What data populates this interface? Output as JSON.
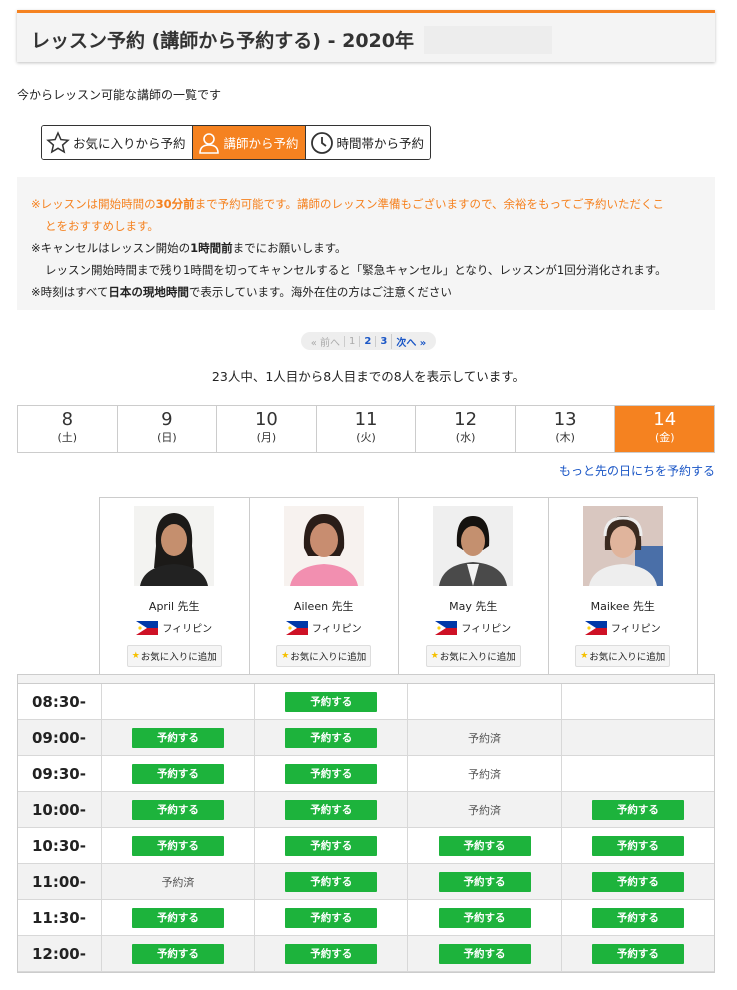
{
  "header": {
    "title": "レッスン予約 (講師から予約する) - 2020年"
  },
  "intro": "今からレッスン可能な講師の一覧です",
  "tabs": [
    {
      "label": "お気に入りから予約",
      "icon": "star-icon",
      "active": false
    },
    {
      "label": "講師から予約",
      "icon": "person-icon",
      "active": true
    },
    {
      "label": "時間帯から予約",
      "icon": "clock-icon",
      "active": false
    }
  ],
  "notice": {
    "line1a": "※レッスンは開始時間の",
    "line1b": "30分前",
    "line1c": "まで予約可能です。講師のレッスン準備もございますので、余裕をもってご予約いただくこ",
    "line1d": "とをおすすめします。",
    "line2a": "※キャンセルはレッスン開始の",
    "line2b": "1時間前",
    "line2c": "までにお願いします。",
    "line3": "レッスン開始時間まで残り1時間を切ってキャンセルすると「緊急キャンセル」となり、レッスンが1回分消化されます。",
    "line4a": "※時刻はすべて",
    "line4b": "日本の現地時間",
    "line4c": "で表示しています。海外在住の方はご注意ください"
  },
  "pager": {
    "prev": "« 前へ",
    "p1": "1",
    "p2": "2",
    "p3": "3",
    "next": "次へ »"
  },
  "count_text": "23人中、1人目から8人目までの8人を表示しています。",
  "days": [
    {
      "num": "8",
      "wd": "(土)"
    },
    {
      "num": "9",
      "wd": "(日)"
    },
    {
      "num": "10",
      "wd": "(月)"
    },
    {
      "num": "11",
      "wd": "(火)"
    },
    {
      "num": "12",
      "wd": "(水)"
    },
    {
      "num": "13",
      "wd": "(木)"
    },
    {
      "num": "14",
      "wd": "(金)"
    }
  ],
  "more_link": "もっと先の日にちを予約する",
  "teachers": [
    {
      "name": "April 先生",
      "country": "フィリピン",
      "fav": "お気に入りに追加"
    },
    {
      "name": "Aileen 先生",
      "country": "フィリピン",
      "fav": "お気に入りに追加"
    },
    {
      "name": "May 先生",
      "country": "フィリピン",
      "fav": "お気に入りに追加"
    },
    {
      "name": "Maikee 先生",
      "country": "フィリピン",
      "fav": "お気に入りに追加"
    }
  ],
  "labels": {
    "reserve": "予約する",
    "booked": "予約済"
  },
  "schedule": [
    {
      "time": "08:30-",
      "slots": [
        "",
        "reserve",
        "",
        ""
      ]
    },
    {
      "time": "09:00-",
      "slots": [
        "reserve",
        "reserve",
        "booked",
        ""
      ]
    },
    {
      "time": "09:30-",
      "slots": [
        "reserve",
        "reserve",
        "booked",
        ""
      ]
    },
    {
      "time": "10:00-",
      "slots": [
        "reserve",
        "reserve",
        "booked",
        "reserve"
      ]
    },
    {
      "time": "10:30-",
      "slots": [
        "reserve",
        "reserve",
        "reserve",
        "reserve"
      ]
    },
    {
      "time": "11:00-",
      "slots": [
        "booked",
        "reserve",
        "reserve",
        "reserve"
      ]
    },
    {
      "time": "11:30-",
      "slots": [
        "reserve",
        "reserve",
        "reserve",
        "reserve"
      ]
    },
    {
      "time": "12:00-",
      "slots": [
        "reserve",
        "reserve",
        "reserve",
        "reserve"
      ]
    }
  ],
  "colors": {
    "accent": "#f58220",
    "reserve_green": "#1db33c",
    "link_blue": "#1a56c6"
  }
}
